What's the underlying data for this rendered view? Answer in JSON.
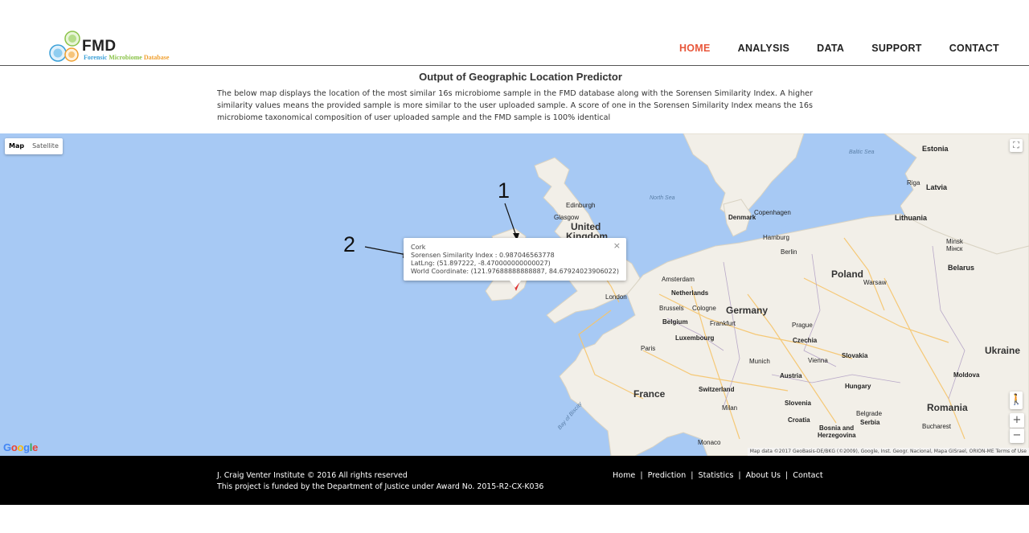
{
  "header": {
    "logo_title": "FMD",
    "logo_sub_1": "Forensic",
    "logo_sub_2": "Microbiome",
    "logo_sub_3": "Database",
    "nav": [
      {
        "label": "HOME",
        "active": true
      },
      {
        "label": "ANALYSIS",
        "active": false
      },
      {
        "label": "DATA",
        "active": false
      },
      {
        "label": "SUPPORT",
        "active": false
      },
      {
        "label": "CONTACT",
        "active": false
      }
    ]
  },
  "main": {
    "title": "Output of Geographic Location Predictor",
    "description": "The below map displays the location of the most similar 16s microbiome sample in the FMD database along with the Sorensen Similarity Index. A higher similarity values means the provided sample is more similar to the user uploaded sample. A score of one in the Sorensen Similarity Index means the 16s microbiome taxonomical composition of user uploaded sample and the FMD sample is 100% identical"
  },
  "map": {
    "map_type_map": "Map",
    "map_type_satellite": "Satellite",
    "fullscreen_icon": "⛶",
    "zoom_in": "+",
    "zoom_out": "−",
    "google_logo": "Google",
    "attribution": "Map data ©2017 GeoBasis-DE/BKG (©2009), Google, Inst. Geogr. Nacional, Mapa GISrael, ORION-ME   Terms of Use",
    "labels": {
      "estonia": "Estonia",
      "latvia": "Latvia",
      "lithuania": "Lithuania",
      "riga": "Riga",
      "baltic_sea": "Baltic Sea",
      "north_sea": "North Sea",
      "edinburgh": "Edinburgh",
      "glasgow": "Glasgow",
      "united_kingdom_1": "United",
      "united_kingdom_2": "Kingdom",
      "denmark": "Denmark",
      "copenhagen": "Copenhagen",
      "minsk": "Minsk",
      "minsk_local": "Мінск",
      "belarus": "Belarus",
      "poland": "Poland",
      "warsaw": "Warsaw",
      "amsterdam": "Amsterdam",
      "netherlands": "Netherlands",
      "hamburg": "Hamburg",
      "berlin": "Berlin",
      "london": "London",
      "brussels": "Brussels",
      "cologne": "Cologne",
      "belgium": "Belgium",
      "germany": "Germany",
      "frankfurt": "Frankfurt",
      "prague": "Prague",
      "czechia": "Czechia",
      "luxembourg": "Luxembourg",
      "paris": "Paris",
      "munich": "Munich",
      "vienna": "Vienna",
      "slovakia": "Slovakia",
      "austria": "Austria",
      "ukraine": "Ukraine",
      "moldova": "Moldova",
      "france": "France",
      "switzerland": "Switzerland",
      "hungary": "Hungary",
      "bay_of_biscay": "Bay of Biscay",
      "milan": "Milan",
      "slovenia": "Slovenia",
      "croatia": "Croatia",
      "romania": "Romania",
      "belgrade": "Belgrade",
      "serbia": "Serbia",
      "bucharest": "Bucharest",
      "bosnia_1": "Bosnia and",
      "bosnia_2": "Herzegovina",
      "monaco": "Monaco"
    },
    "info_window": {
      "title": "Cork",
      "similarity": "Sorensen Similarity Index : 0.987046563778",
      "latlng": "LatLng: (51.897222, -8.470000000000027)",
      "world": "World Coordinate: (121.97688888888887, 84.67924023906022)",
      "close_icon": "×"
    },
    "annotation_1": "1",
    "annotation_2": "2"
  },
  "footer": {
    "copyright": "J. Craig Venter Institute © 2016 All rights reserved",
    "funding": "This project is funded by the Department of Justice under Award No. 2015-R2-CX-K036",
    "links": [
      "Home",
      "Prediction",
      "Statistics",
      "About Us",
      "Contact"
    ]
  },
  "colors": {
    "accent": "#e8563a",
    "sea": "#a7c9f4",
    "land": "#f2efe8",
    "footer_bg": "#000000"
  }
}
